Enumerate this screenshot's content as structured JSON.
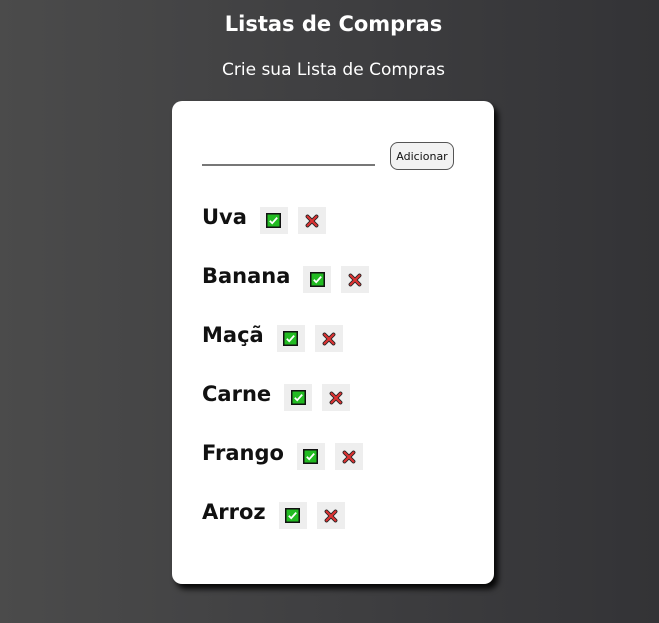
{
  "header": {
    "title": "Listas de Compras",
    "subtitle": "Crie sua Lista de Compras"
  },
  "form": {
    "input_value": "",
    "add_label": "Adicionar"
  },
  "items": [
    {
      "name": "Uva"
    },
    {
      "name": "Banana"
    },
    {
      "name": "Maçã"
    },
    {
      "name": "Carne"
    },
    {
      "name": "Frango"
    },
    {
      "name": "Arroz"
    }
  ],
  "icons": {
    "check": "check-icon",
    "remove": "cross-icon"
  },
  "colors": {
    "check_green": "#22bb22",
    "cross_red": "#dd3333"
  }
}
